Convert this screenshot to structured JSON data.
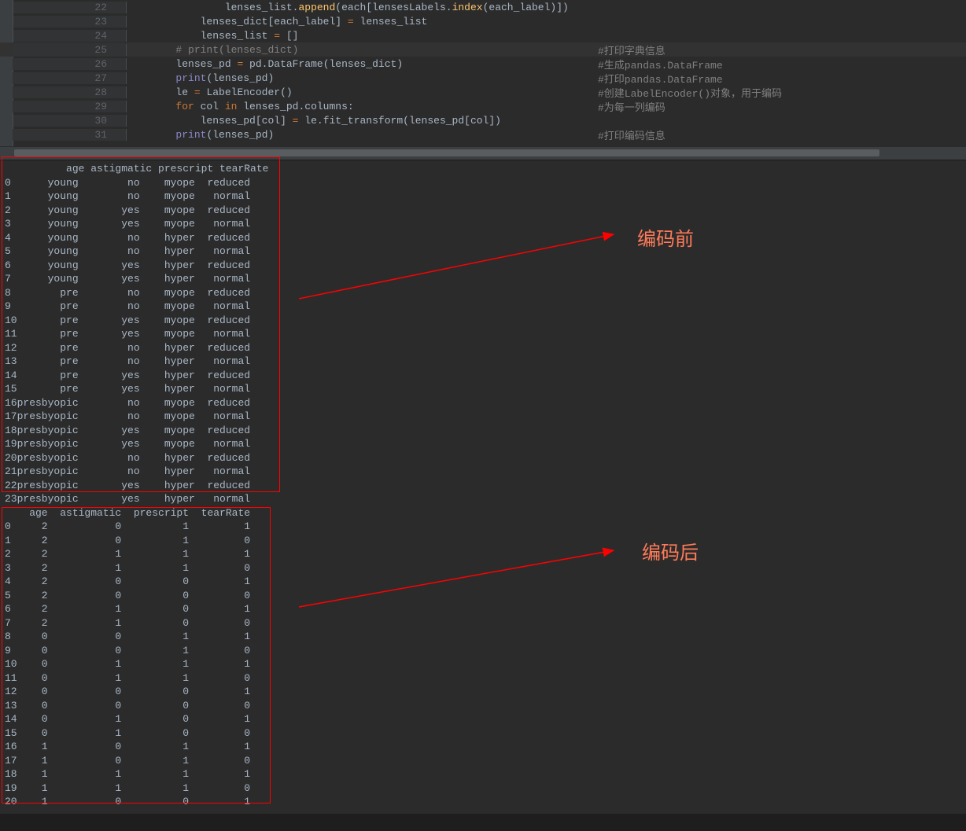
{
  "code_lines": [
    {
      "n": "22",
      "indent": "                ",
      "tokens": [
        [
          "id",
          "lenses_list"
        ],
        [
          "op",
          "."
        ],
        [
          "fn",
          "append"
        ],
        [
          "op",
          "("
        ],
        [
          "id",
          "each"
        ],
        [
          "op",
          "["
        ],
        [
          "id",
          "lensesLabels"
        ],
        [
          "op",
          "."
        ],
        [
          "fn",
          "index"
        ],
        [
          "op",
          "("
        ],
        [
          "id",
          "each_label"
        ],
        [
          "op",
          ")])"
        ]
      ]
    },
    {
      "n": "23",
      "indent": "            ",
      "tokens": [
        [
          "id",
          "lenses_dict"
        ],
        [
          "op",
          "["
        ],
        [
          "id",
          "each_label"
        ],
        [
          "op",
          "] "
        ],
        [
          "eq",
          "="
        ],
        [
          "op",
          " "
        ],
        [
          "id",
          "lenses_list"
        ]
      ]
    },
    {
      "n": "24",
      "indent": "            ",
      "tokens": [
        [
          "id",
          "lenses_list "
        ],
        [
          "eq",
          "="
        ],
        [
          "op",
          " []"
        ]
      ]
    },
    {
      "n": "25",
      "indent": "        ",
      "highlight": true,
      "tokens": [
        [
          "comment",
          "# print(lenses_dict)"
        ]
      ],
      "rcomment": "#打印字典信息",
      "rpos": 760
    },
    {
      "n": "26",
      "indent": "        ",
      "tokens": [
        [
          "id",
          "lenses_pd "
        ],
        [
          "eq",
          "="
        ],
        [
          "id",
          " pd"
        ],
        [
          "op",
          "."
        ],
        [
          "id",
          "DataFrame"
        ],
        [
          "op",
          "("
        ],
        [
          "id",
          "lenses_dict"
        ],
        [
          "op",
          ")"
        ]
      ],
      "rcomment": "#生成pandas.DataFrame",
      "rpos": 760
    },
    {
      "n": "27",
      "indent": "        ",
      "tokens": [
        [
          "builtin",
          "print"
        ],
        [
          "op",
          "("
        ],
        [
          "id",
          "lenses_pd"
        ],
        [
          "op",
          ")"
        ]
      ],
      "rcomment": "#打印pandas.DataFrame",
      "rpos": 760
    },
    {
      "n": "28",
      "indent": "        ",
      "tokens": [
        [
          "id",
          "le "
        ],
        [
          "eq",
          "="
        ],
        [
          "id",
          " LabelEncoder"
        ],
        [
          "op",
          "()"
        ]
      ],
      "rcomment": "#创建LabelEncoder()对象，用于编码",
      "rpos": 760
    },
    {
      "n": "29",
      "indent": "        ",
      "tokens": [
        [
          "kw",
          "for"
        ],
        [
          "id",
          " col "
        ],
        [
          "kw",
          "in"
        ],
        [
          "id",
          " lenses_pd"
        ],
        [
          "op",
          "."
        ],
        [
          "id",
          "columns:"
        ]
      ],
      "rcomment": "#为每一列编码",
      "rpos": 760
    },
    {
      "n": "30",
      "indent": "            ",
      "tokens": [
        [
          "id",
          "lenses_pd"
        ],
        [
          "op",
          "["
        ],
        [
          "id",
          "col"
        ],
        [
          "op",
          "] "
        ],
        [
          "eq",
          "="
        ],
        [
          "id",
          " le"
        ],
        [
          "op",
          "."
        ],
        [
          "id",
          "fit_transform"
        ],
        [
          "op",
          "("
        ],
        [
          "id",
          "lenses_pd"
        ],
        [
          "op",
          "["
        ],
        [
          "id",
          "col"
        ],
        [
          "op",
          "])"
        ]
      ]
    },
    {
      "n": "31",
      "indent": "        ",
      "tokens": [
        [
          "builtin",
          "print"
        ],
        [
          "op",
          "("
        ],
        [
          "id",
          "lenses_pd"
        ],
        [
          "op",
          ")"
        ]
      ],
      "rcomment": "#打印编码信息",
      "rpos": 760
    }
  ],
  "table_before": {
    "header": "          age astigmatic prescript tearRate",
    "rows": [
      [
        "0 ",
        "     young",
        "        no",
        "    myope",
        "  reduced"
      ],
      [
        "1 ",
        "     young",
        "        no",
        "    myope",
        "   normal"
      ],
      [
        "2 ",
        "     young",
        "       yes",
        "    myope",
        "  reduced"
      ],
      [
        "3 ",
        "     young",
        "       yes",
        "    myope",
        "   normal"
      ],
      [
        "4 ",
        "     young",
        "        no",
        "    hyper",
        "  reduced"
      ],
      [
        "5 ",
        "     young",
        "        no",
        "    hyper",
        "   normal"
      ],
      [
        "6 ",
        "     young",
        "       yes",
        "    hyper",
        "  reduced"
      ],
      [
        "7 ",
        "     young",
        "       yes",
        "    hyper",
        "   normal"
      ],
      [
        "8 ",
        "       pre",
        "        no",
        "    myope",
        "  reduced"
      ],
      [
        "9 ",
        "       pre",
        "        no",
        "    myope",
        "   normal"
      ],
      [
        "10",
        "       pre",
        "       yes",
        "    myope",
        "  reduced"
      ],
      [
        "11",
        "       pre",
        "       yes",
        "    myope",
        "   normal"
      ],
      [
        "12",
        "       pre",
        "        no",
        "    hyper",
        "  reduced"
      ],
      [
        "13",
        "       pre",
        "        no",
        "    hyper",
        "   normal"
      ],
      [
        "14",
        "       pre",
        "       yes",
        "    hyper",
        "  reduced"
      ],
      [
        "15",
        "       pre",
        "       yes",
        "    hyper",
        "   normal"
      ],
      [
        "16",
        "presbyopic",
        "        no",
        "    myope",
        "  reduced"
      ],
      [
        "17",
        "presbyopic",
        "        no",
        "    myope",
        "   normal"
      ],
      [
        "18",
        "presbyopic",
        "       yes",
        "    myope",
        "  reduced"
      ],
      [
        "19",
        "presbyopic",
        "       yes",
        "    myope",
        "   normal"
      ],
      [
        "20",
        "presbyopic",
        "        no",
        "    hyper",
        "  reduced"
      ],
      [
        "21",
        "presbyopic",
        "        no",
        "    hyper",
        "   normal"
      ],
      [
        "22",
        "presbyopic",
        "       yes",
        "    hyper",
        "  reduced"
      ],
      [
        "23",
        "presbyopic",
        "       yes",
        "    hyper",
        "   normal"
      ]
    ]
  },
  "table_after": {
    "header": "    age  astigmatic  prescript  tearRate",
    "rows": [
      [
        "0 ",
        "    2",
        "           0",
        "          1",
        "         1"
      ],
      [
        "1 ",
        "    2",
        "           0",
        "          1",
        "         0"
      ],
      [
        "2 ",
        "    2",
        "           1",
        "          1",
        "         1"
      ],
      [
        "3 ",
        "    2",
        "           1",
        "          1",
        "         0"
      ],
      [
        "4 ",
        "    2",
        "           0",
        "          0",
        "         1"
      ],
      [
        "5 ",
        "    2",
        "           0",
        "          0",
        "         0"
      ],
      [
        "6 ",
        "    2",
        "           1",
        "          0",
        "         1"
      ],
      [
        "7 ",
        "    2",
        "           1",
        "          0",
        "         0"
      ],
      [
        "8 ",
        "    0",
        "           0",
        "          1",
        "         1"
      ],
      [
        "9 ",
        "    0",
        "           0",
        "          1",
        "         0"
      ],
      [
        "10",
        "    0",
        "           1",
        "          1",
        "         1"
      ],
      [
        "11",
        "    0",
        "           1",
        "          1",
        "         0"
      ],
      [
        "12",
        "    0",
        "           0",
        "          0",
        "         1"
      ],
      [
        "13",
        "    0",
        "           0",
        "          0",
        "         0"
      ],
      [
        "14",
        "    0",
        "           1",
        "          0",
        "         1"
      ],
      [
        "15",
        "    0",
        "           1",
        "          0",
        "         0"
      ],
      [
        "16",
        "    1",
        "           0",
        "          1",
        "         1"
      ],
      [
        "17",
        "    1",
        "           0",
        "          1",
        "         0"
      ],
      [
        "18",
        "    1",
        "           1",
        "          1",
        "         1"
      ],
      [
        "19",
        "    1",
        "           1",
        "          1",
        "         0"
      ],
      [
        "20",
        "    1",
        "           0",
        "          0",
        "         1"
      ]
    ]
  },
  "annotations": {
    "before_label": "编码前",
    "after_label": "编码后"
  }
}
